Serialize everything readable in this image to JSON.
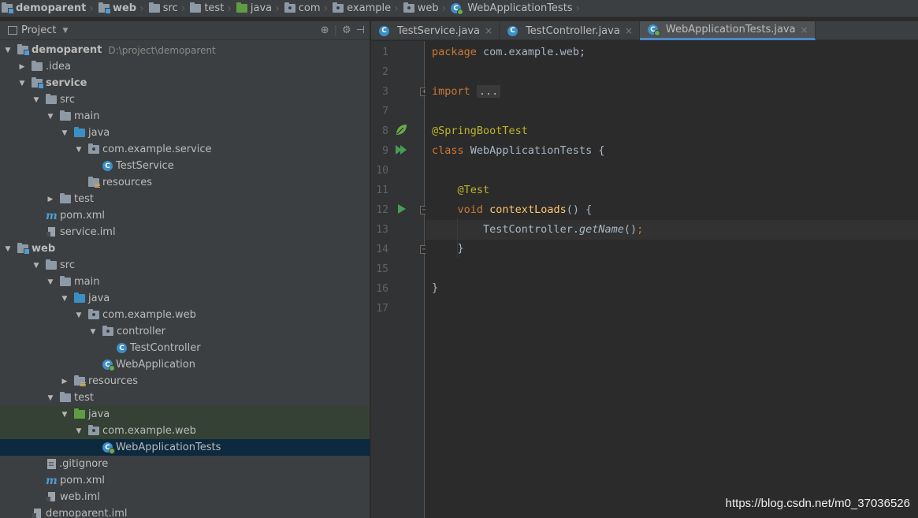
{
  "breadcrumb": [
    {
      "label": "demoparent",
      "icon": "module-folder-icon"
    },
    {
      "label": "web",
      "icon": "module-folder-icon"
    },
    {
      "label": "src",
      "icon": "folder-icon"
    },
    {
      "label": "test",
      "icon": "folder-icon"
    },
    {
      "label": "java",
      "icon": "test-source-folder-icon"
    },
    {
      "label": "com",
      "icon": "package-icon"
    },
    {
      "label": "example",
      "icon": "package-icon"
    },
    {
      "label": "web",
      "icon": "package-icon"
    },
    {
      "label": "WebApplicationTests",
      "icon": "spring-class-icon"
    }
  ],
  "project_panel": {
    "title": "Project",
    "tree": [
      {
        "label": "demoparent",
        "sub": "D:\\project\\demoparent",
        "bold": true
      },
      {
        "label": ".idea"
      },
      {
        "label": "service",
        "bold": true
      },
      {
        "label": "src"
      },
      {
        "label": "main"
      },
      {
        "label": "java"
      },
      {
        "label": "com.example.service"
      },
      {
        "label": "TestService"
      },
      {
        "label": "resources"
      },
      {
        "label": "test"
      },
      {
        "label": "pom.xml"
      },
      {
        "label": "service.iml"
      },
      {
        "label": "web",
        "bold": true
      },
      {
        "label": "src"
      },
      {
        "label": "main"
      },
      {
        "label": "java"
      },
      {
        "label": "com.example.web"
      },
      {
        "label": "controller"
      },
      {
        "label": "TestController"
      },
      {
        "label": "WebApplication"
      },
      {
        "label": "resources"
      },
      {
        "label": "test"
      },
      {
        "label": "java"
      },
      {
        "label": "com.example.web"
      },
      {
        "label": "WebApplicationTests"
      },
      {
        "label": ".gitignore"
      },
      {
        "label": "pom.xml"
      },
      {
        "label": "web.iml"
      },
      {
        "label": "demoparent.iml"
      }
    ]
  },
  "editor": {
    "tabs": [
      {
        "label": "TestService.java"
      },
      {
        "label": "TestController.java"
      },
      {
        "label": "WebApplicationTests.java",
        "active": true
      }
    ],
    "line_numbers": [
      "1",
      "2",
      "3",
      "7",
      "8",
      "9",
      "10",
      "11",
      "12",
      "13",
      "14",
      "15",
      "16",
      "17"
    ],
    "code": {
      "l1_kw": "package",
      "l1_rest": " com.example.web;",
      "l3_kw": "import",
      "l3_fold": "...",
      "l8_ann": "@SpringBootTest",
      "l9_kw": "class",
      "l9_rest": " WebApplicationTests {",
      "l11_ann": "@Test",
      "l12_kw": "void",
      "l12_fn": "contextLoads",
      "l12_rest": "() {",
      "l13_a": "TestController.",
      "l13_st": "getName",
      "l13_b": "()",
      "l13_semi": ";",
      "l14": "}",
      "l16": "}"
    }
  },
  "watermark": "https://blog.csdn.net/m0_37036526"
}
